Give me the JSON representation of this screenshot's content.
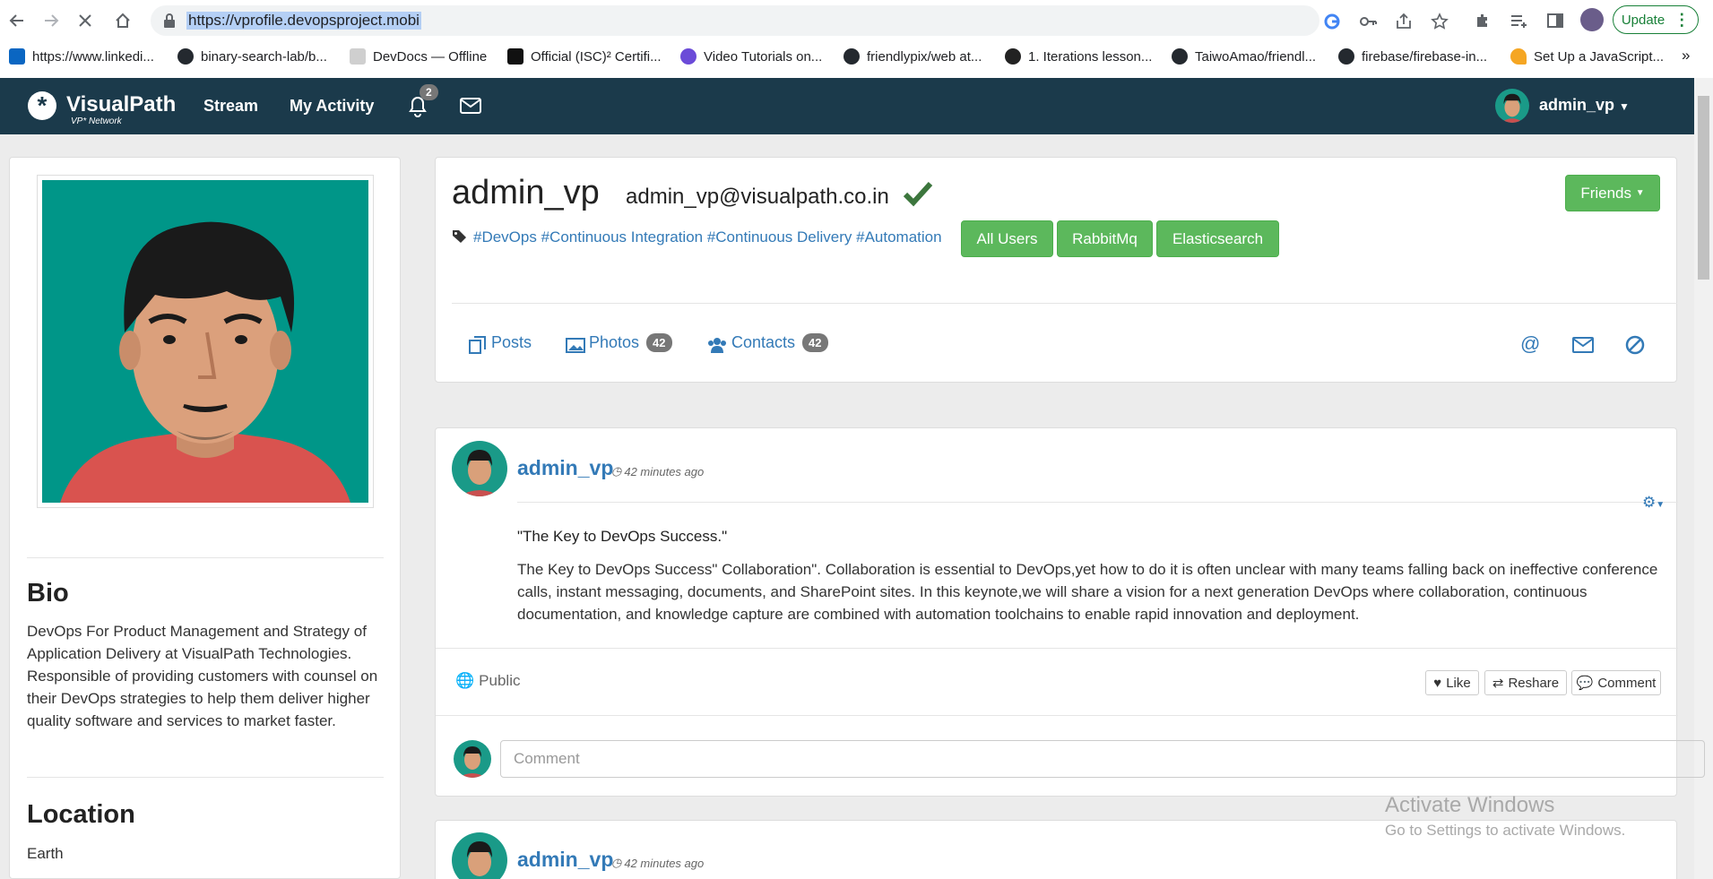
{
  "browser": {
    "url": "https://vprofile.devopsproject.mobi",
    "update_label": "Update",
    "bookmarks": [
      {
        "label": "https://www.linkedi...",
        "color": "#0a66c2"
      },
      {
        "label": "binary-search-lab/b...",
        "color": "#24292f"
      },
      {
        "label": "DevDocs — Offline",
        "color": "#888888"
      },
      {
        "label": "Official (ISC)² Certifi...",
        "color": "#111111"
      },
      {
        "label": "Video Tutorials on...",
        "color": "#6b4bd8"
      },
      {
        "label": "friendlypix/web at...",
        "color": "#24292f"
      },
      {
        "label": "1. Iterations lesson...",
        "color": "#222222"
      },
      {
        "label": "TaiwoAmao/friendl...",
        "color": "#24292f"
      },
      {
        "label": "firebase/firebase-in...",
        "color": "#24292f"
      },
      {
        "label": "Set Up a JavaScript...",
        "color": "#f5a623"
      }
    ]
  },
  "nav": {
    "brand": "VisualPath",
    "brand_sub": "VP* Network",
    "stream": "Stream",
    "activity": "My Activity",
    "notif_count": "2",
    "user": "admin_vp"
  },
  "sidebar": {
    "bio_title": "Bio",
    "bio": "DevOps For Product Management and Strategy of Application Delivery at VisualPath Technologies. Responsible of providing customers with counsel on their DevOps strategies to help them deliver higher quality software and services to market faster.",
    "location_title": "Location",
    "location": "Earth"
  },
  "profile": {
    "name": "admin_vp",
    "email": "admin_vp@visualpath.co.in",
    "friends_label": "Friends",
    "tags": "#DevOps #Continuous Integration #Continuous Delivery #Automation",
    "tag_buttons": [
      "All Users",
      "RabbitMq",
      "Elasticsearch"
    ],
    "tabs": {
      "posts": "Posts",
      "photos": "Photos",
      "photos_count": "42",
      "contacts": "Contacts",
      "contacts_count": "42"
    }
  },
  "posts": [
    {
      "author": "admin_vp",
      "time": "42 minutes ago",
      "title": "\"The Key to DevOps Success.\"",
      "body": "The Key to DevOps Success\" Collaboration\". Collaboration is essential to DevOps,yet how to do it is often unclear with many teams falling back on ineffective conference calls, instant messaging, documents, and SharePoint sites. In this keynote,we will share a vision for a next generation DevOps where collaboration, continuous documentation, and knowledge capture are combined with automation toolchains to enable rapid innovation and deployment.",
      "visibility": "Public",
      "like": "Like",
      "reshare": "Reshare",
      "comment": "Comment",
      "comment_placeholder": "Comment"
    },
    {
      "author": "admin_vp",
      "time": "42 minutes ago"
    }
  ],
  "watermark": {
    "line1": "Activate Windows",
    "line2": "Go to Settings to activate Windows."
  },
  "colors": {
    "navbar": "#1b3a4b",
    "green": "#5cb85c",
    "link": "#337ab7"
  }
}
